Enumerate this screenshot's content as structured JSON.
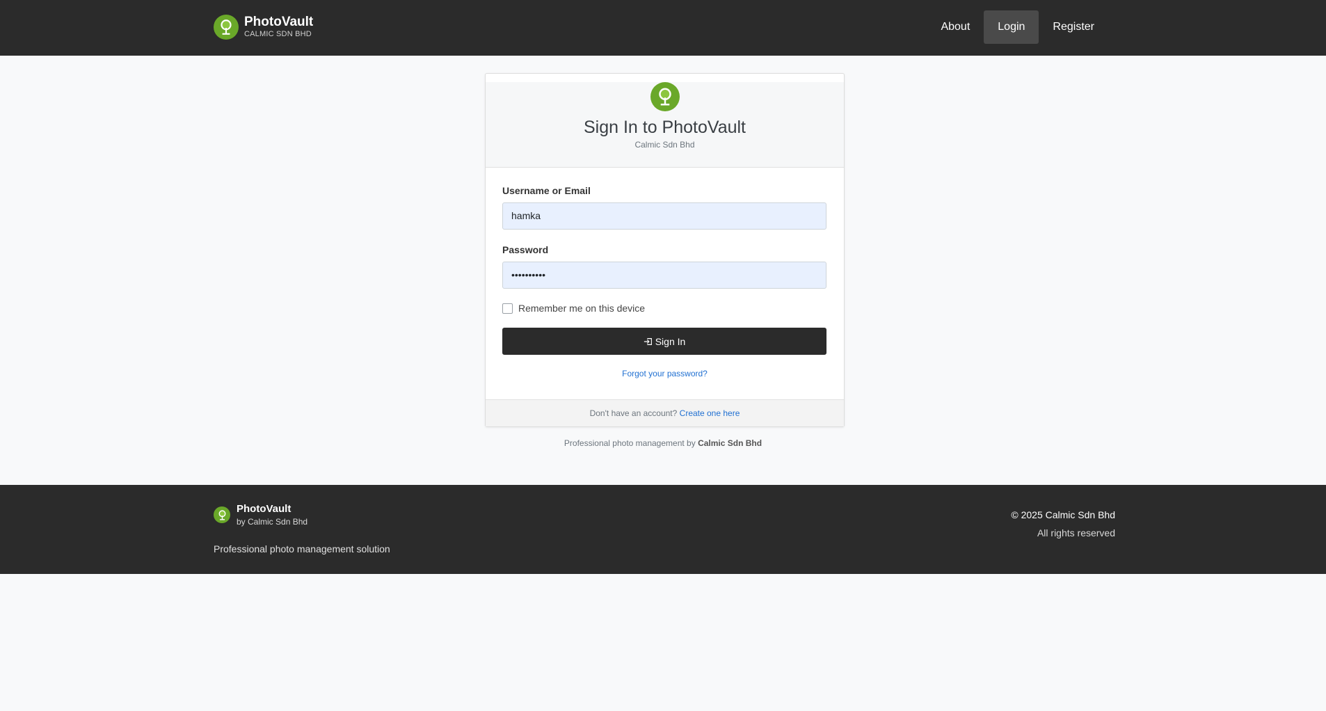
{
  "brand": {
    "name": "PhotoVault",
    "company": "CALMIC SDN BHD",
    "icon": "tree-logo-icon",
    "color": "#6aa829"
  },
  "nav": {
    "about": "About",
    "login": "Login",
    "register": "Register"
  },
  "card": {
    "title": "Sign In to PhotoVault",
    "subtitle": "Calmic Sdn Bhd",
    "username_label": "Username or Email",
    "username_value": "hamka",
    "password_label": "Password",
    "password_value": "••••••••••",
    "remember_label": "Remember me on this device",
    "remember_checked": false,
    "signin_label": "Sign In",
    "forgot_label": "Forgot your password?",
    "no_account_text": "Don't have an account?",
    "create_link": "Create one here"
  },
  "tagline": {
    "prefix": "Professional photo management by",
    "company": "Calmic Sdn Bhd"
  },
  "footer": {
    "name": "PhotoVault",
    "by": "by Calmic Sdn Bhd",
    "description": "Professional photo management solution",
    "copyright": "© 2025 Calmic Sdn Bhd",
    "rights": "All rights reserved"
  },
  "colors": {
    "dark": "#2b2b2b",
    "link": "#1f6fd1",
    "input_bg": "#e8f0fe"
  }
}
